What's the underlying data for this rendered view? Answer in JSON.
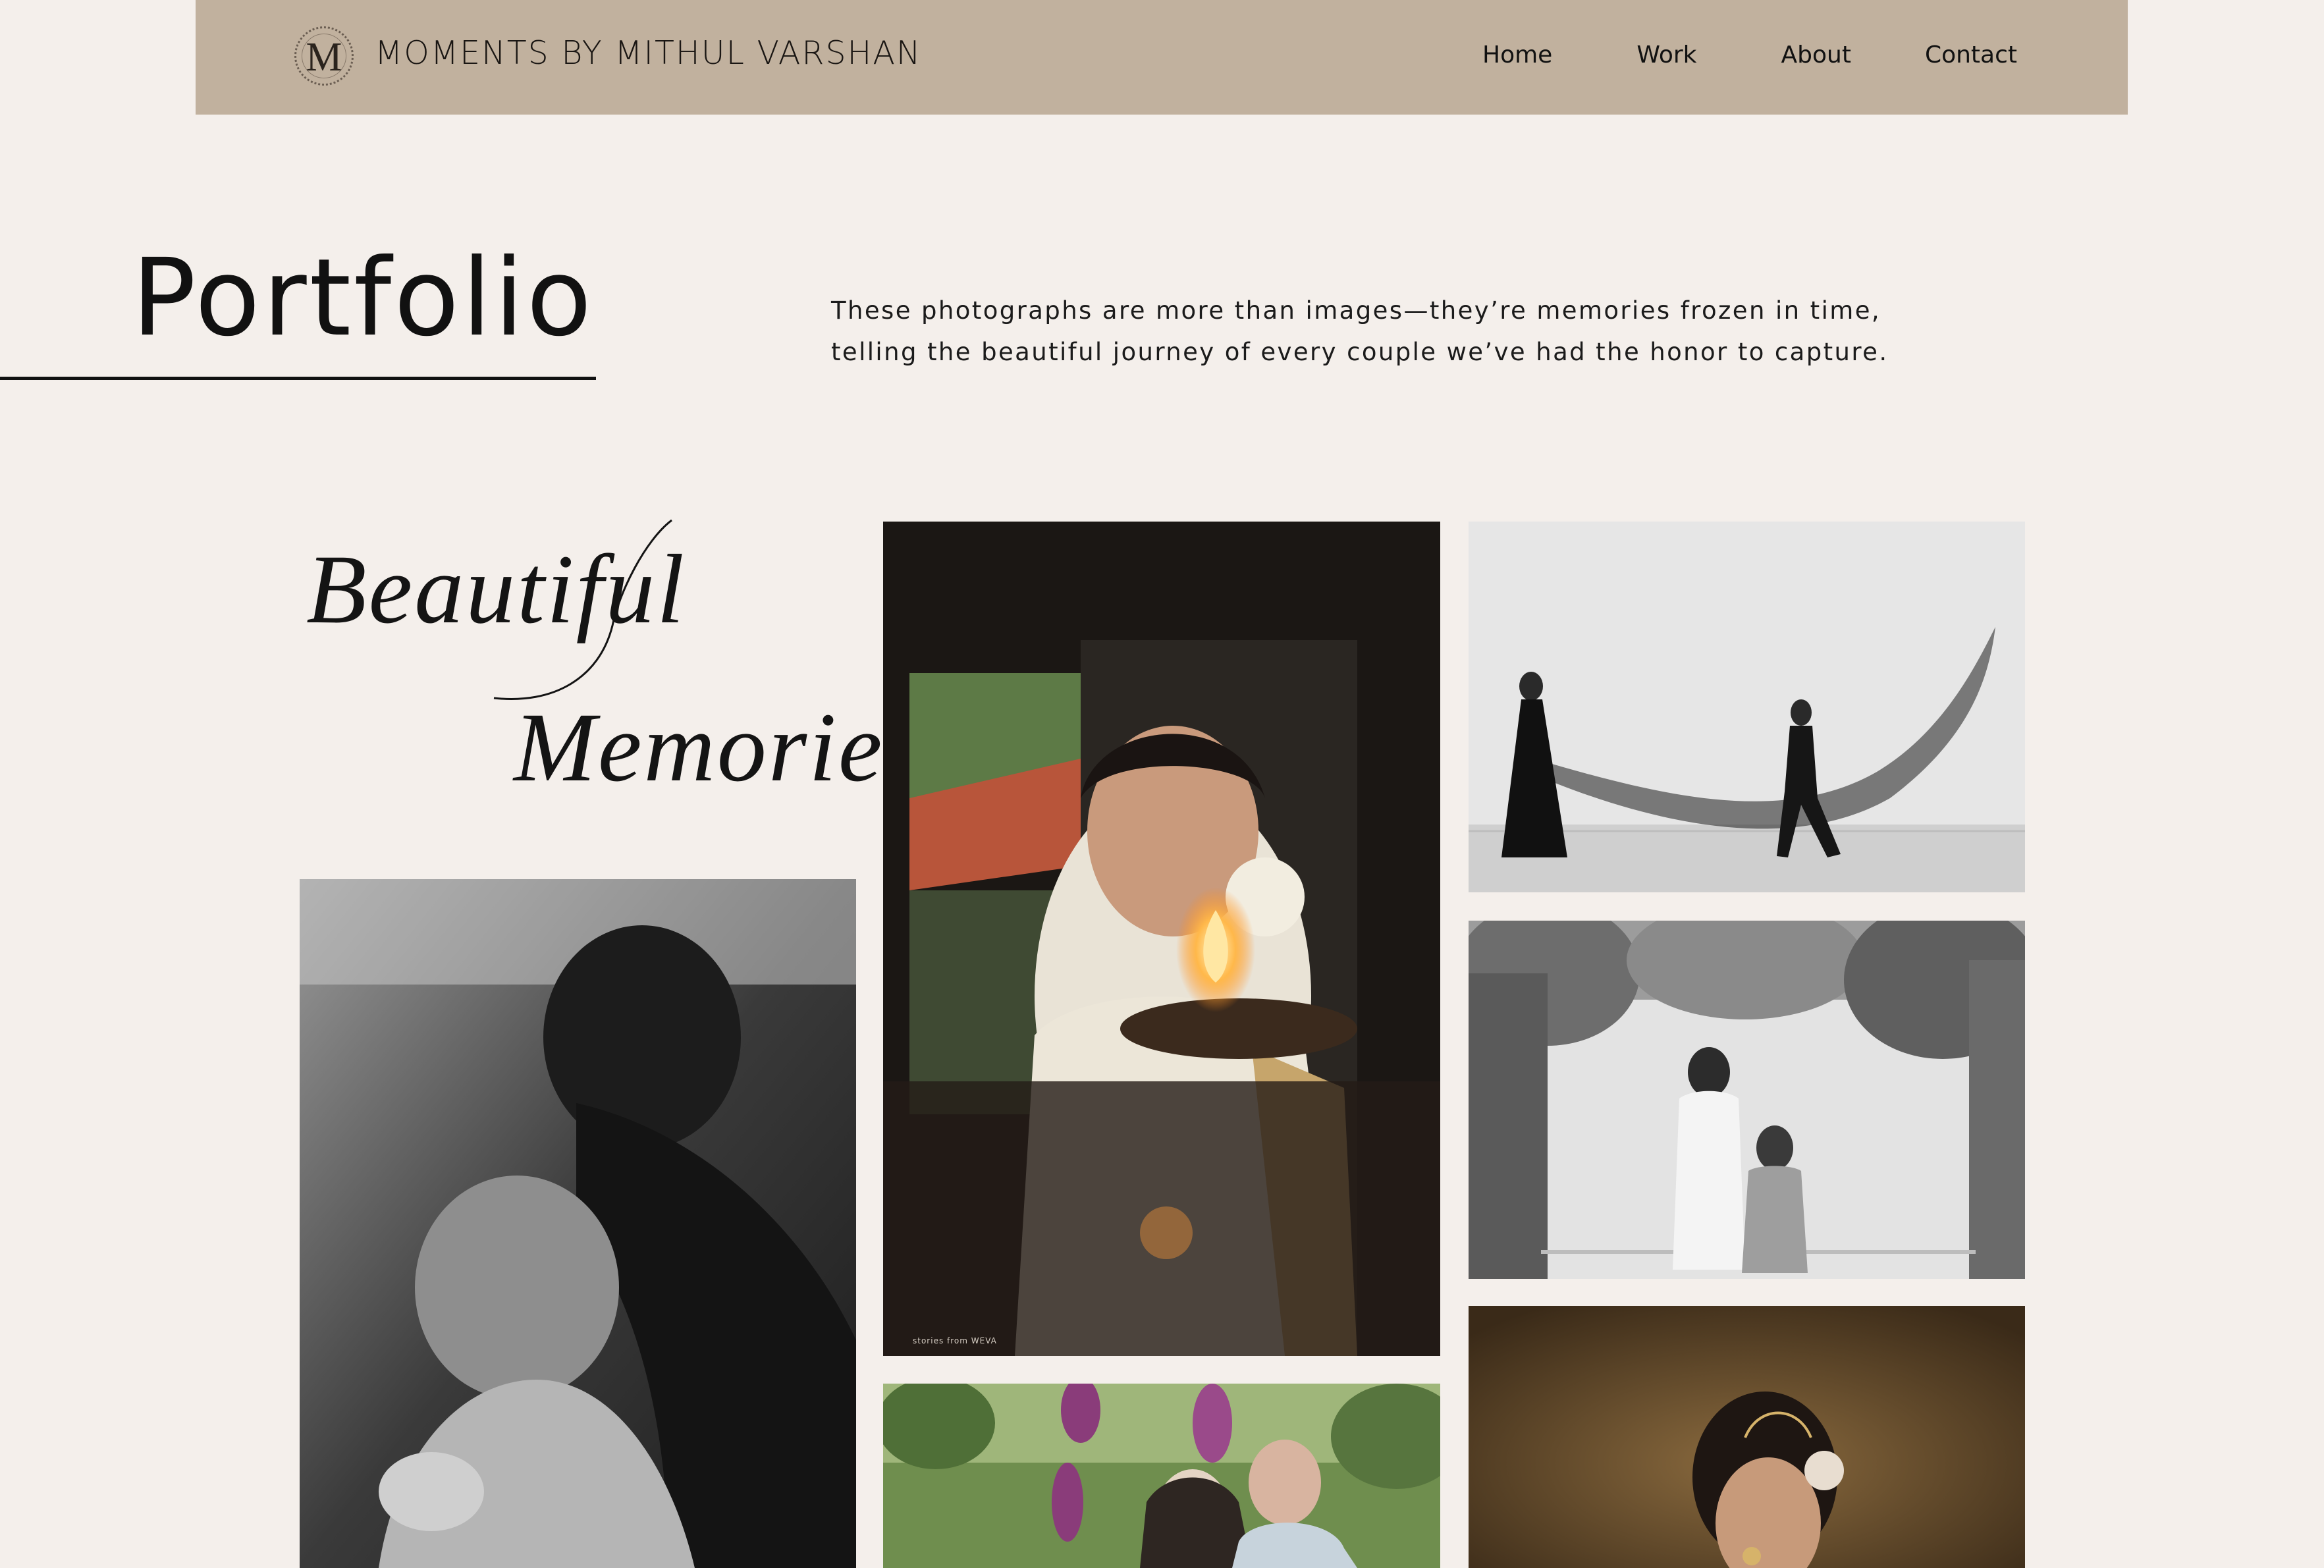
{
  "header": {
    "logo_letter": "M",
    "brand": "MOMENTS BY MITHUL VARSHAN",
    "nav": [
      {
        "label": "Home"
      },
      {
        "label": "Work"
      },
      {
        "label": "About"
      },
      {
        "label": "Contact"
      }
    ],
    "background": "#c1b19e"
  },
  "page": {
    "title": "Portfolio",
    "intro_line_1": "These photographs are more than images—they’re memories frozen in time,",
    "intro_line_2": "telling the beautiful journey of every couple we’ve had the honor to capture.",
    "script_line_1": "Beautiful",
    "script_line_2": "Memories",
    "background": "#f4efeb"
  },
  "gallery": {
    "photos": [
      {
        "name": "bw-embrace-grandmother",
        "tone": "black-and-white"
      },
      {
        "name": "bride-with-oil-lamp",
        "tone": "color",
        "watermark": "stories from WEVA"
      },
      {
        "name": "couple-under-flowers",
        "tone": "color"
      },
      {
        "name": "couple-beach-veil",
        "tone": "black-and-white"
      },
      {
        "name": "couple-floral-arch",
        "tone": "black-and-white"
      },
      {
        "name": "bride-portrait-golden",
        "tone": "color"
      }
    ]
  }
}
